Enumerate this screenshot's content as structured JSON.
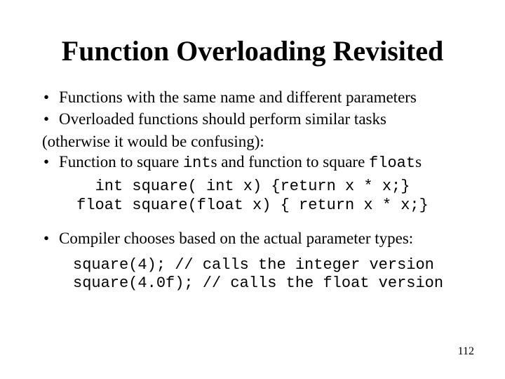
{
  "title": "Function Overloading Revisited",
  "bullets": {
    "b1": "Functions with the same name and different parameters",
    "b2": "Overloaded functions should perform similar tasks",
    "b2_cont": "(otherwise it would be confusing):",
    "b3_pre": "Function to square ",
    "b3_code1": "int",
    "b3_mid": "s and function to square ",
    "b3_code2": "float",
    "b3_post": "s",
    "b4": "Compiler chooses based on the actual parameter types:"
  },
  "code1_line1": "int square( int x) {return x * x;}",
  "code1_line2": "float square(float x) { return x * x;}",
  "code2_line1": "square(4); // calls the integer version",
  "code2_line2": "square(4.0f); // calls the float version",
  "page_number": "112",
  "bullet_char": "•"
}
